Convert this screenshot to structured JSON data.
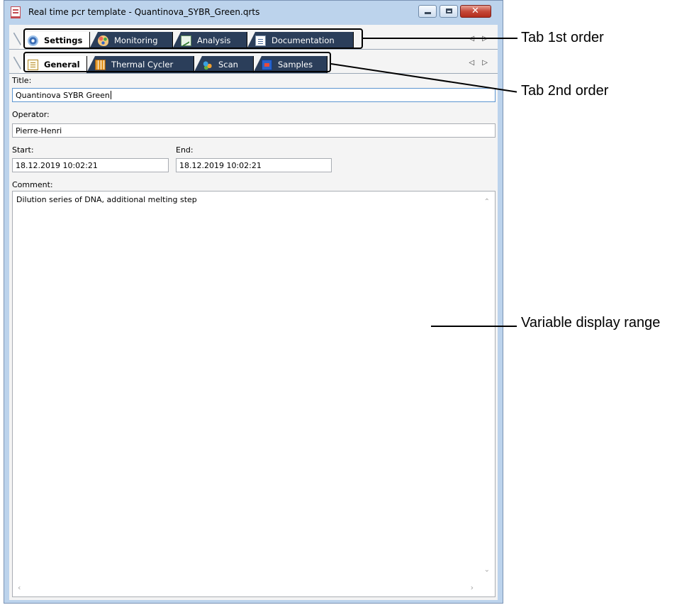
{
  "window": {
    "title": "Real time pcr template - Quantinova_SYBR_Green.qrts"
  },
  "tabs_first_order": [
    {
      "label": "Settings",
      "icon": "gear-icon",
      "active": true
    },
    {
      "label": "Monitoring",
      "icon": "palette-icon",
      "active": false
    },
    {
      "label": "Analysis",
      "icon": "chart-icon",
      "active": false
    },
    {
      "label": "Documentation",
      "icon": "document-icon",
      "active": false
    }
  ],
  "tabs_second_order": [
    {
      "label": "General",
      "icon": "general-icon",
      "active": true
    },
    {
      "label": "Thermal Cycler",
      "icon": "grid-icon",
      "active": false
    },
    {
      "label": "Scan",
      "icon": "scan-icon",
      "active": false
    },
    {
      "label": "Samples",
      "icon": "samples-icon",
      "active": false
    }
  ],
  "tab_scroll_arrows": "◁ ▷",
  "form": {
    "title_label": "Title:",
    "title_value": "Quantinova SYBR Green",
    "operator_label": "Operator:",
    "operator_value": "Pierre-Henri",
    "start_label": "Start:",
    "start_value": "18.12.2019 10:02:21",
    "end_label": "End:",
    "end_value": "18.12.2019 10:02:21",
    "comment_label": "Comment:",
    "comment_value": "Dilution series of DNA, additional melting step"
  },
  "annotations": {
    "tab_1st_order": "Tab 1st order",
    "tab_2nd_order": "Tab 2nd order",
    "variable_display_range": "Variable display range"
  },
  "colors": {
    "inactive_tab": "#2b3e5a",
    "window_frame": "#bcd3ec",
    "close_button": "#c5493a"
  }
}
